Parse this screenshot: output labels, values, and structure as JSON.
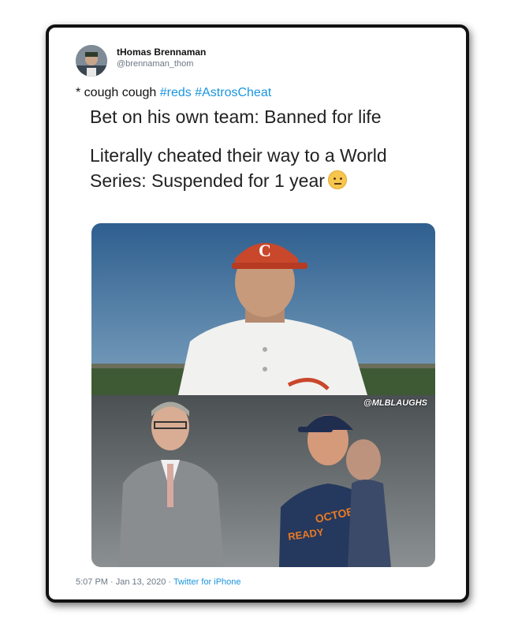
{
  "tweet": {
    "author_name": "tHomas Brennaman",
    "author_handle": "@brennaman_thom",
    "intro_prefix": "* cough cough ",
    "hashtags": [
      "#reds",
      "#AstrosCheat"
    ],
    "line1": "Bet on his own team: Banned for life",
    "line2": "Literally cheated their way to a World Series: Suspended for 1 year",
    "emoji_icon": "face-with-raised-eyebrow-icon",
    "media_watermark": "@MLBLAUGHS",
    "time": "5:07 PM · Jan 13, 2020",
    "separator": " · ",
    "source": "Twitter for iPhone",
    "colors": {
      "link": "#1b95e0",
      "text": "#222222",
      "meta": "#6b7784"
    }
  }
}
